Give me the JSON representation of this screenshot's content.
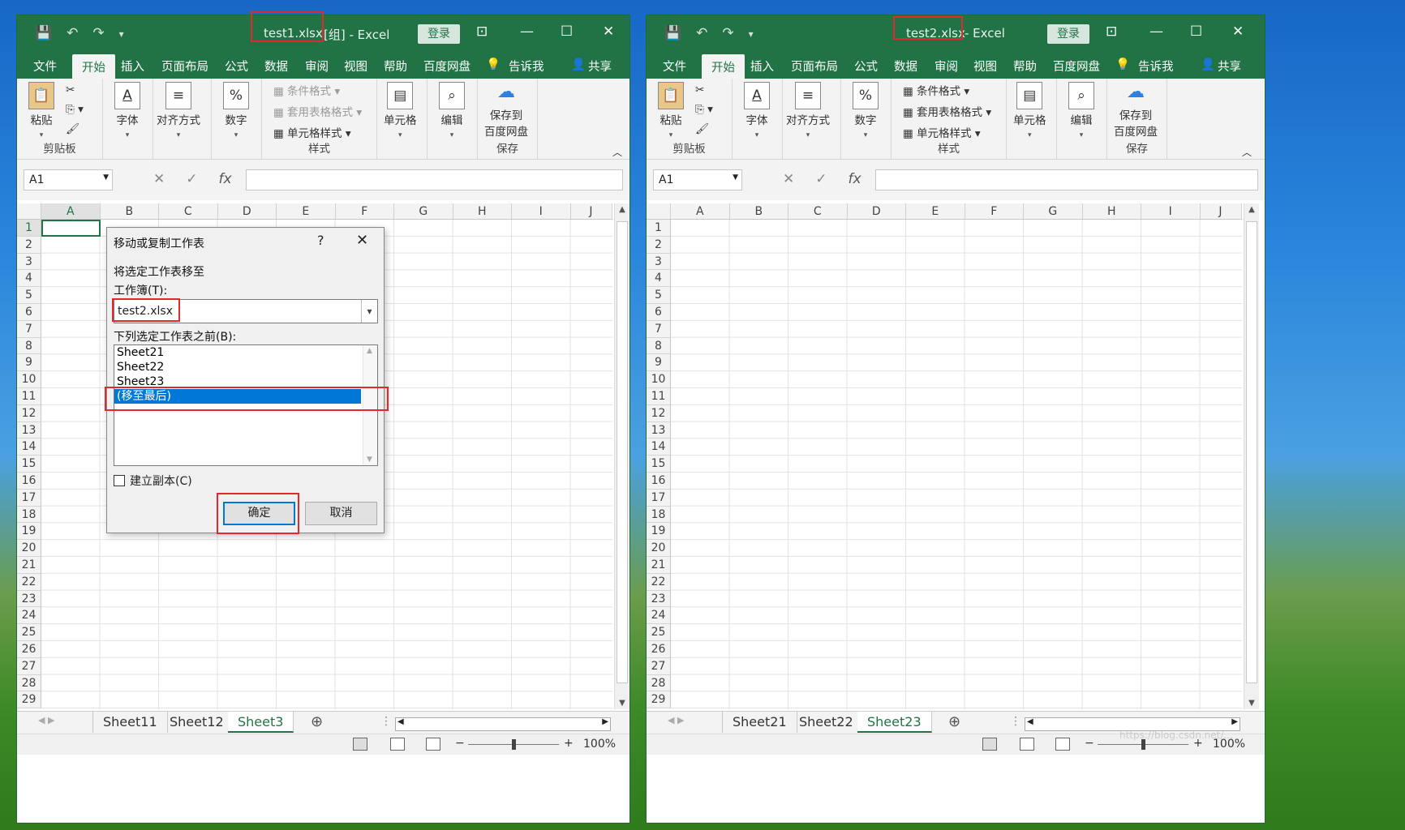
{
  "left": {
    "title_file": "test1.xlsx",
    "title_rest": "[组]  -  Excel",
    "login": "登录",
    "menu": [
      "文件",
      "开始",
      "插入",
      "页面布局",
      "公式",
      "数据",
      "审阅",
      "视图",
      "帮助",
      "百度网盘",
      "告诉我",
      "共享"
    ],
    "ribbon": {
      "paste": "粘贴",
      "clipboard": "剪贴板",
      "font": "字体",
      "align": "对齐方式",
      "number": "数字",
      "cond_format": "条件格式",
      "table_format": "套用表格格式",
      "cell_style": "单元格样式",
      "styles": "样式",
      "cells": "单元格",
      "edit": "编辑",
      "save_to": "保存到",
      "baidu": "百度网盘",
      "save": "保存"
    },
    "namebox": "A1",
    "columns": [
      "A",
      "B",
      "C",
      "D",
      "E",
      "F",
      "G",
      "H",
      "I",
      "J"
    ],
    "rows": [
      "1",
      "2",
      "3",
      "4",
      "5",
      "6",
      "7",
      "8",
      "9",
      "10",
      "11",
      "12",
      "13",
      "14",
      "15",
      "16",
      "17",
      "18",
      "19",
      "20",
      "21",
      "22",
      "23",
      "24",
      "25",
      "26",
      "27",
      "28",
      "29"
    ],
    "tabs": [
      "Sheet11",
      "Sheet12",
      "Sheet3"
    ],
    "active_tab": "Sheet3",
    "zoom": "100%"
  },
  "right": {
    "title_file": "test2.xlsx",
    "title_rest": "-  Excel",
    "login": "登录",
    "menu": [
      "文件",
      "开始",
      "插入",
      "页面布局",
      "公式",
      "数据",
      "审阅",
      "视图",
      "帮助",
      "百度网盘",
      "告诉我",
      "共享"
    ],
    "ribbon": {
      "paste": "粘贴",
      "clipboard": "剪贴板",
      "font": "字体",
      "align": "对齐方式",
      "number": "数字",
      "cond_format": "条件格式",
      "table_format": "套用表格格式",
      "cell_style": "单元格样式",
      "styles": "样式",
      "cells": "单元格",
      "edit": "编辑",
      "save_to": "保存到",
      "baidu": "百度网盘",
      "save": "保存"
    },
    "namebox": "A1",
    "columns": [
      "A",
      "B",
      "C",
      "D",
      "E",
      "F",
      "G",
      "H",
      "I",
      "J"
    ],
    "rows": [
      "1",
      "2",
      "3",
      "4",
      "5",
      "6",
      "7",
      "8",
      "9",
      "10",
      "11",
      "12",
      "13",
      "14",
      "15",
      "16",
      "17",
      "18",
      "19",
      "20",
      "21",
      "22",
      "23",
      "24",
      "25",
      "26",
      "27",
      "28",
      "29"
    ],
    "tabs": [
      "Sheet21",
      "Sheet22",
      "Sheet23"
    ],
    "active_tab": "Sheet23",
    "zoom": "100%"
  },
  "dialog": {
    "title": "移动或复制工作表",
    "help": "?",
    "close": "✕",
    "move_to_label": "将选定工作表移至",
    "workbook_label": "工作簿(T):",
    "workbook_value": "test2.xlsx",
    "before_label": "下列选定工作表之前(B):",
    "list": [
      "Sheet21",
      "Sheet22",
      "Sheet23",
      "(移至最后)"
    ],
    "selected": "(移至最后)",
    "copy_label": "建立副本(C)",
    "ok": "确定",
    "cancel": "取消"
  },
  "watermark": "https://blog.csdn.net/..."
}
